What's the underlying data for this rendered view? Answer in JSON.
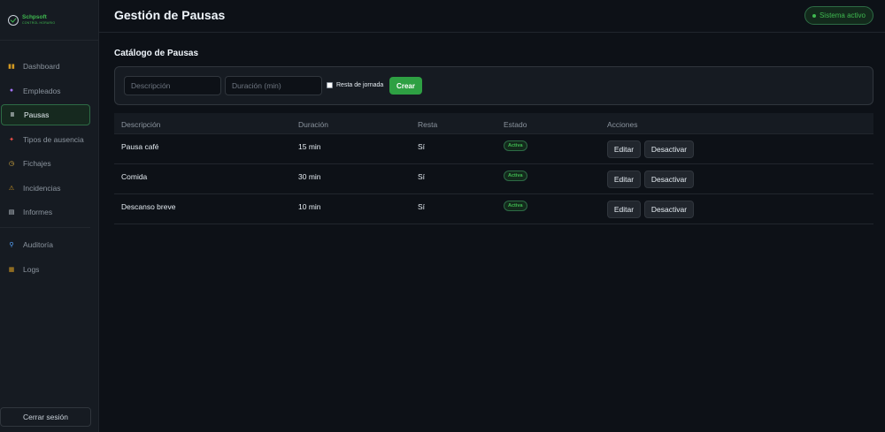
{
  "brand": {
    "name": "Schpsoft",
    "subtitle": "CONTROL HORARIO"
  },
  "sidebar": {
    "items": [
      {
        "label": "Dashboard",
        "icon": "bar-chart-icon",
        "glyph": "▮▮"
      },
      {
        "label": "Empleados",
        "icon": "user-icon",
        "glyph": "●"
      },
      {
        "label": "Pausas",
        "icon": "pause-icon",
        "glyph": "II",
        "active": true
      },
      {
        "label": "Tipos de ausencia",
        "icon": "pushpin-icon",
        "glyph": "✦"
      },
      {
        "label": "Fichajes",
        "icon": "clock-icon",
        "glyph": "◷"
      },
      {
        "label": "Incidencias",
        "icon": "warning-icon",
        "glyph": "⚠"
      },
      {
        "label": "Informes",
        "icon": "document-icon",
        "glyph": "▤"
      }
    ],
    "secondary_items": [
      {
        "label": "Auditoría",
        "icon": "magnifier-icon",
        "glyph": "⚲"
      },
      {
        "label": "Logs",
        "icon": "scroll-icon",
        "glyph": "▦"
      }
    ],
    "logout_label": "Cerrar sesión"
  },
  "header": {
    "title": "Gestión de Pausas",
    "status_label": "Sistema activo"
  },
  "catalog": {
    "title": "Catálogo de Pausas",
    "form": {
      "description_placeholder": "Descripción",
      "duration_placeholder": "Duración (min)",
      "checkbox_label": "Resta de jornada",
      "create_label": "Crear"
    },
    "columns": [
      "Descripción",
      "Duración",
      "Resta",
      "Estado",
      "Acciones"
    ],
    "rows": [
      {
        "description": "Pausa café",
        "duration": "15 min",
        "resta": "Sí",
        "status": "Activa",
        "edit": "Editar",
        "deactivate": "Desactivar"
      },
      {
        "description": "Comida",
        "duration": "30 min",
        "resta": "Sí",
        "status": "Activa",
        "edit": "Editar",
        "deactivate": "Desactivar"
      },
      {
        "description": "Descanso breve",
        "duration": "10 min",
        "resta": "Sí",
        "status": "Activa",
        "edit": "Editar",
        "deactivate": "Desactivar"
      }
    ]
  },
  "colors": {
    "accent": "#2ea043",
    "background": "#0d1117",
    "panel": "#161b22",
    "status_green": "#3fb950"
  }
}
